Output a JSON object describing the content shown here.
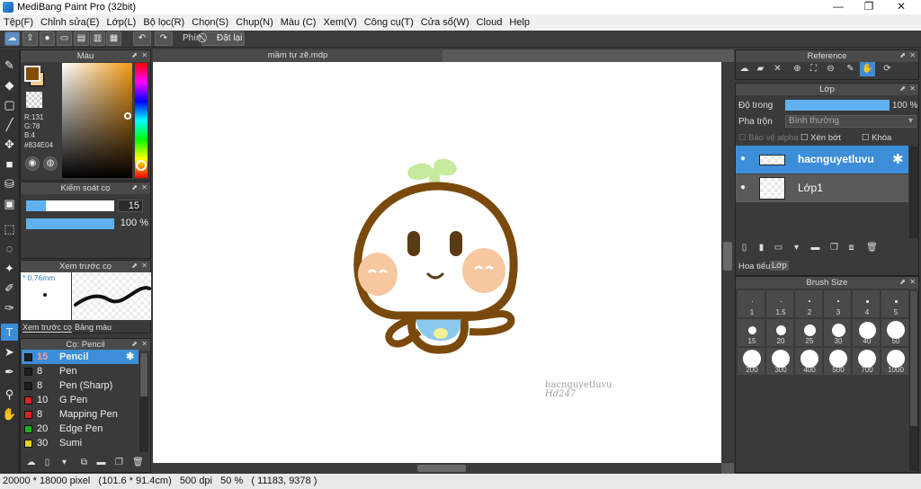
{
  "window": {
    "title": "MediBang Paint Pro (32bit)",
    "minimize": "—",
    "maximize": "❐",
    "close": "✕"
  },
  "menu": [
    "Tệp(F)",
    "Chỉnh sửa(E)",
    "Lớp(L)",
    "Bộ lọc(R)",
    "Chọn(S)",
    "Chụp(N)",
    "Màu (C)",
    "Xem(V)",
    "Công cụ(T)",
    "Cửa sổ(W)",
    "Cloud",
    "Help"
  ],
  "toolbar": {
    "shortcut_label": "Phím",
    "reset_label": "Đặt lại"
  },
  "color_panel": {
    "title": "Màu",
    "r_label": "R:131",
    "g_label": "G:78",
    "b_label": "B:4",
    "hex": "#834E04",
    "primary_color": "#834E04",
    "secondary_color": "#F6C98E"
  },
  "brush_control": {
    "title": "Kiểm soát cọ",
    "size": "15",
    "opacity": "100 %",
    "size_fraction": 0.22,
    "opacity_fraction": 1.0
  },
  "brush_preview": {
    "title": "Xem trước cọ",
    "size_label": "* 0.76mm",
    "tabs": [
      "Xem trước cọ",
      "Bảng màu"
    ]
  },
  "brush_list": {
    "title": "Cọ: Pencil",
    "items": [
      {
        "size": "15",
        "name": "Pencil",
        "color": "#1e1e1e",
        "selected": true
      },
      {
        "size": "8",
        "name": "Pen",
        "color": "#1e1e1e",
        "selected": false
      },
      {
        "size": "8",
        "name": "Pen (Sharp)",
        "color": "#1e1e1e",
        "selected": false
      },
      {
        "size": "10",
        "name": "G Pen",
        "color": "#e02020",
        "selected": false
      },
      {
        "size": "8",
        "name": "Mapping Pen",
        "color": "#e02020",
        "selected": false
      },
      {
        "size": "20",
        "name": "Edge Pen",
        "color": "#1fb01f",
        "selected": false
      },
      {
        "size": "30",
        "name": "Sumi",
        "color": "#e8d020",
        "selected": false
      }
    ]
  },
  "document": {
    "tab_title": "mầm tự zẽ.mdp",
    "signature_line1": "hacnguyetluvu",
    "signature_line2": "Hd247"
  },
  "reference_panel": {
    "title": "Reference"
  },
  "layer_panel": {
    "title": "Lớp",
    "opacity_label": "Độ trong",
    "opacity_value": "100 %",
    "blend_label": "Pha trộn",
    "blend_value": "Bình thường",
    "protect_alpha": "Bảo vệ alpha",
    "clipping": "Xén bớt",
    "lock": "Khóa",
    "layers": [
      {
        "name": "hacnguyetluvu",
        "selected": true
      },
      {
        "name": "Lớp1",
        "selected": false
      }
    ],
    "tabs": [
      "Hoa tiểu",
      "Lớp"
    ]
  },
  "brush_size_panel": {
    "title": "Brush Size",
    "sizes": [
      "1",
      "1.5",
      "2",
      "3",
      "4",
      "5",
      "15",
      "20",
      "25",
      "30",
      "40",
      "50",
      "200",
      "300",
      "400",
      "500",
      "700",
      "1000"
    ]
  },
  "status": {
    "text": "20000 * 18000 pixel   (101.6 * 91.4cm)   500 dpi   50 %   ( 11183, 9378 )"
  }
}
